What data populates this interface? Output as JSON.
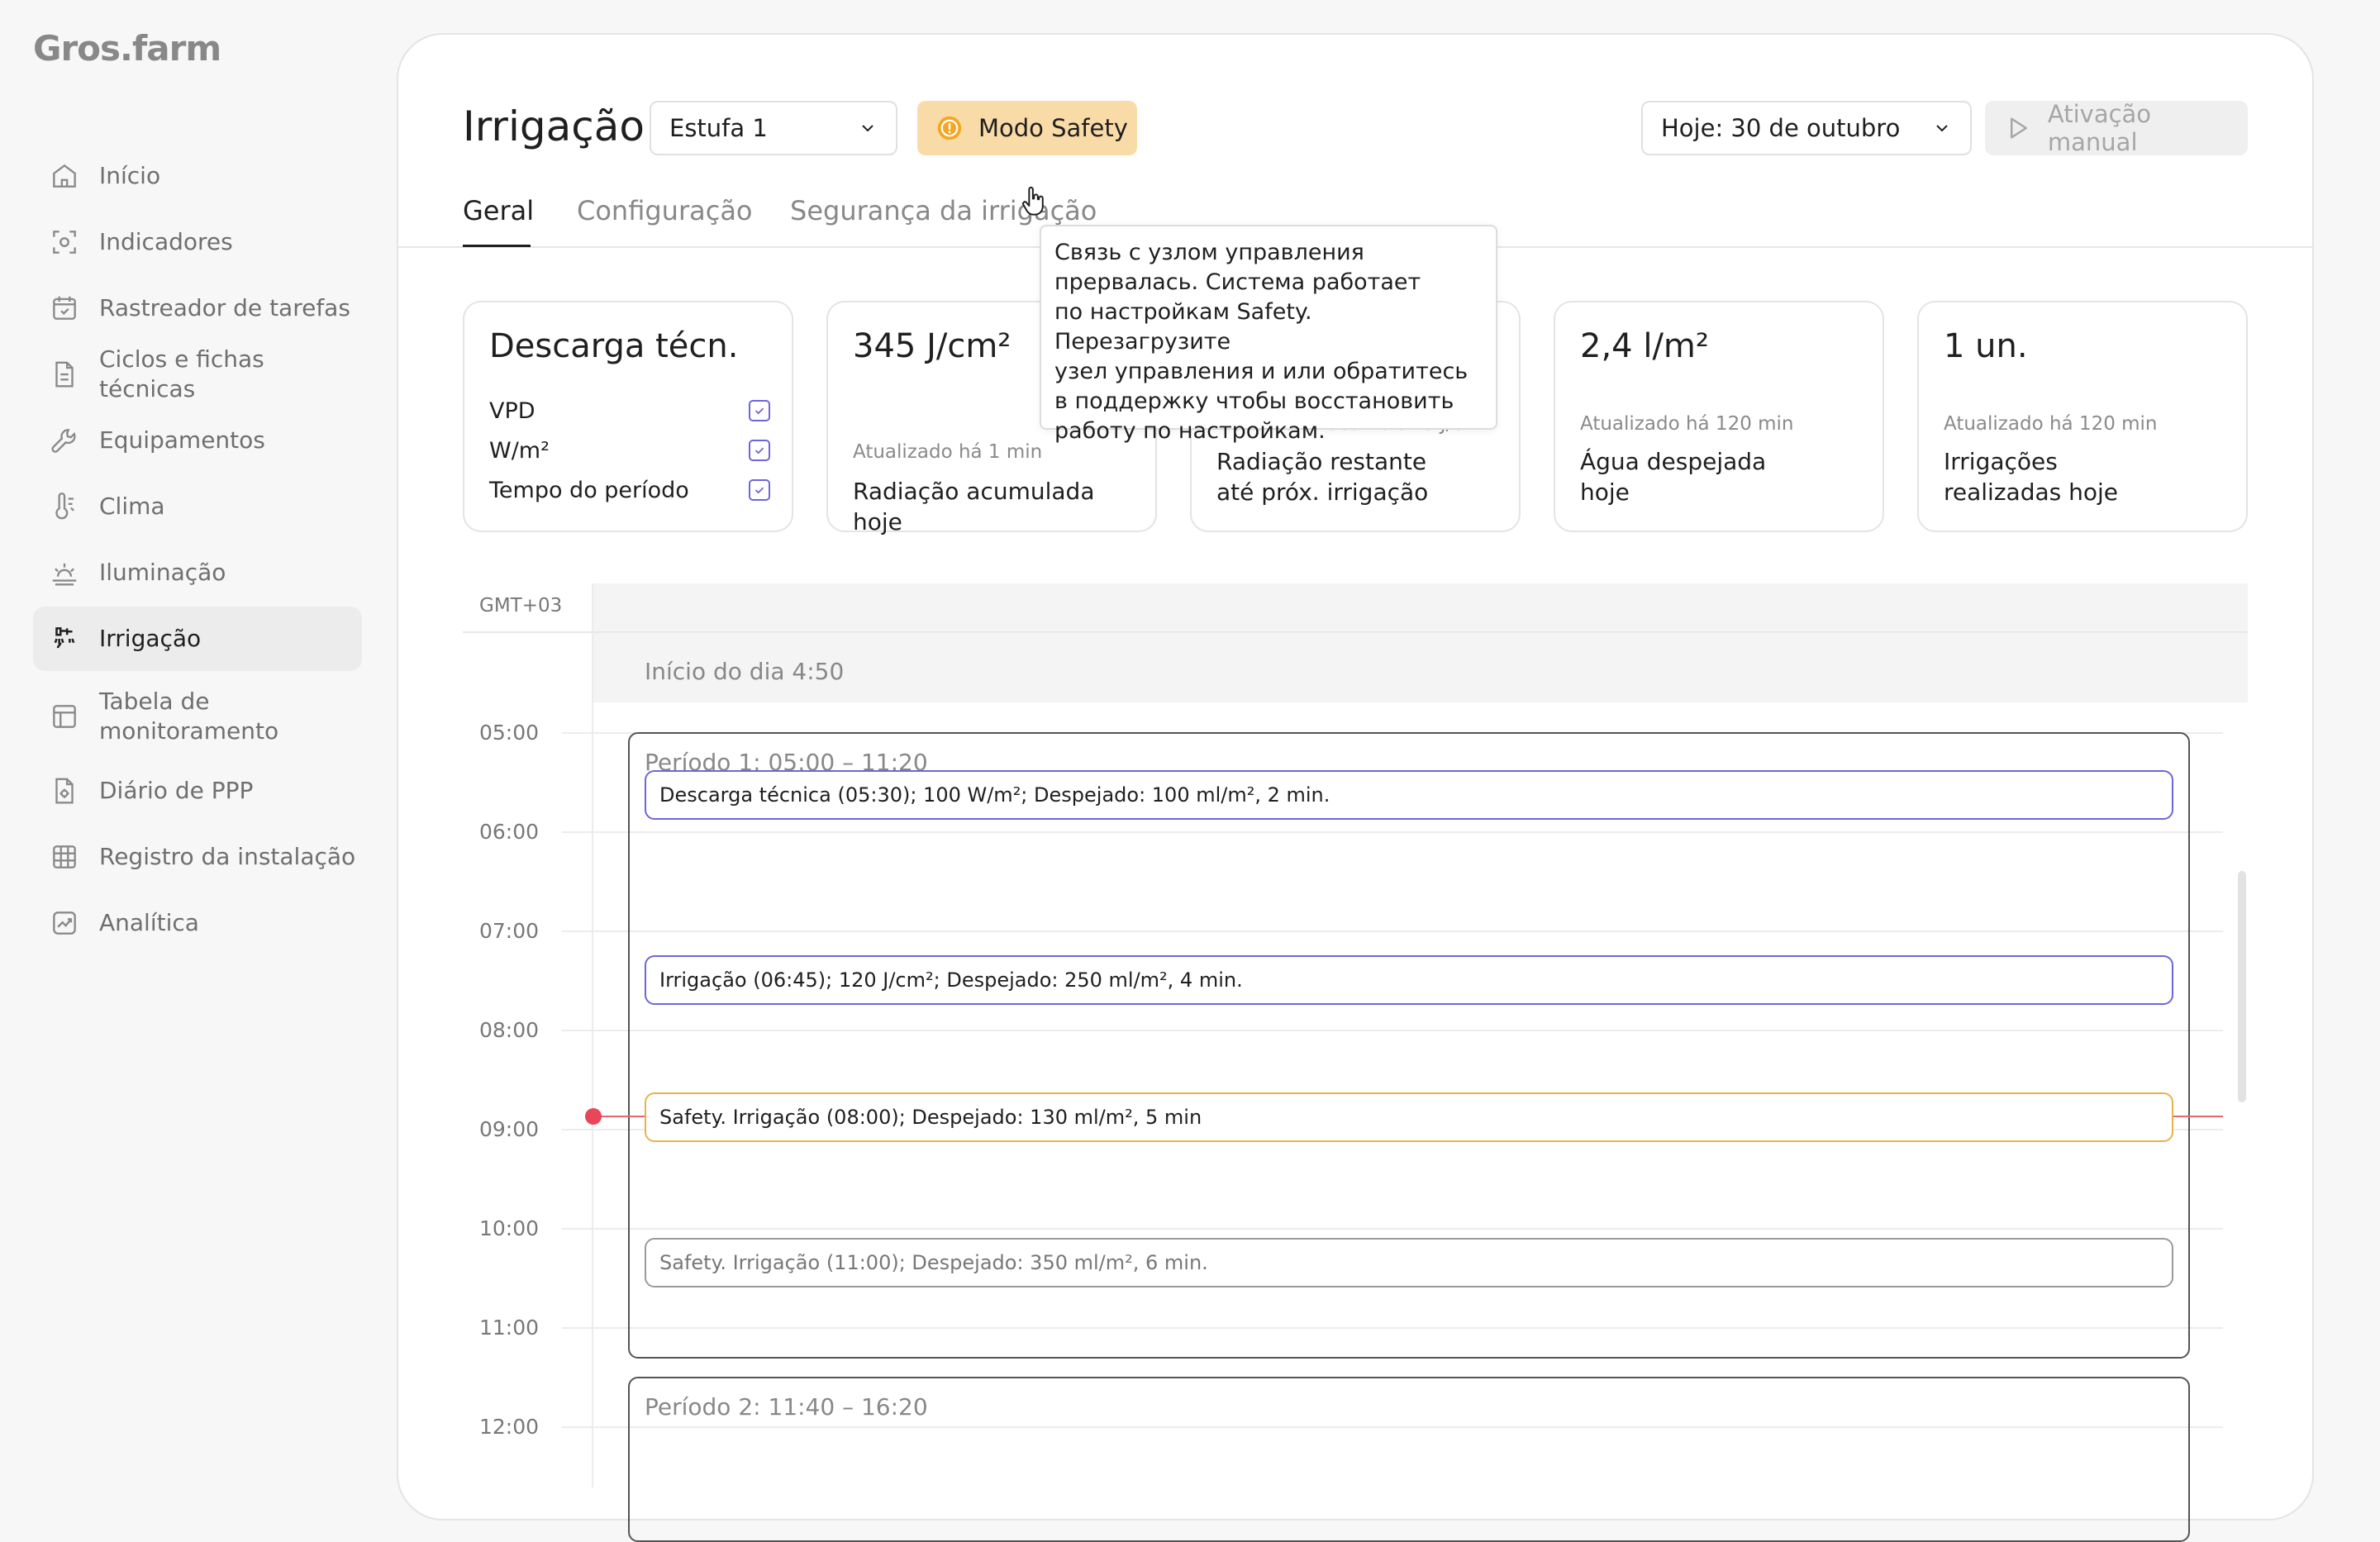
{
  "app": {
    "logo": "Gros.farm"
  },
  "sidebar": {
    "items": [
      {
        "label": "Início",
        "icon": "home-icon"
      },
      {
        "label": "Indicadores",
        "icon": "indicators-icon"
      },
      {
        "label": "Rastreador de tarefas",
        "icon": "calendar-check-icon"
      },
      {
        "label": "Ciclos e fichas técnicas",
        "icon": "document-icon"
      },
      {
        "label": "Equipamentos",
        "icon": "wrench-icon"
      },
      {
        "label": "Clima",
        "icon": "thermometer-icon"
      },
      {
        "label": "Iluminação",
        "icon": "sunrise-icon"
      },
      {
        "label": "Irrigação",
        "icon": "irrigation-icon",
        "active": true
      },
      {
        "label": "Tabela de monitoramento",
        "icon": "table-icon"
      },
      {
        "label": "Diário de PPP",
        "icon": "file-gear-icon"
      },
      {
        "label": "Registro da instalação",
        "icon": "grid-icon"
      },
      {
        "label": "Analítica",
        "icon": "chart-icon"
      }
    ]
  },
  "header": {
    "title": "Irrigação",
    "greenhouse_select": "Estufa 1",
    "safety_button": "Modo Safety",
    "date_select": "Hoje: 30 de outubro",
    "manual_button": "Ativação manual"
  },
  "tabs": [
    {
      "label": "Geral",
      "active": true
    },
    {
      "label": "Configuração"
    },
    {
      "label": "Segurança da irrigação"
    }
  ],
  "tooltip": {
    "lines": [
      "Связь с узлом управления",
      "прервалась. Система работает",
      "по настройкам Safety. Перезагрузите",
      "узел управления и или обратитесь",
      "в поддержку чтобы восстановить",
      "работу по настройкам."
    ]
  },
  "cards": {
    "discharge": {
      "title": "Descarga técn.",
      "options": [
        {
          "label": "VPD",
          "checked": true
        },
        {
          "label": "W/m²",
          "checked": true
        },
        {
          "label": "Tempo do período",
          "checked": true
        }
      ]
    },
    "radiation": {
      "value": "345 J/cm²",
      "updated": "Atualizado há 1 min",
      "desc": "Radiação acumulada hoje"
    },
    "remaining": {
      "updated_partial": "Necessário acumular 0 J/cm²",
      "desc_line1": "Radiação restante",
      "desc_line2": "até próx. irrigação"
    },
    "water": {
      "value": "2,4 l/m²",
      "updated": "Atualizado há 120 min",
      "desc_line1": "Água despejada",
      "desc_line2": "hoje"
    },
    "irrigations": {
      "value": "1 un.",
      "updated": "Atualizado há 120 min",
      "desc_line1": "Irrigações",
      "desc_line2": "realizadas hoje"
    }
  },
  "timeline": {
    "timezone": "GMT+03",
    "day_start": "Início do dia 4:50",
    "hours": [
      "05:00",
      "06:00",
      "07:00",
      "08:00",
      "09:00",
      "10:00",
      "11:00",
      "12:00"
    ],
    "periods": [
      {
        "title": "Período 1: 05:00 – 11:20"
      },
      {
        "title": "Período 2: 11:40 – 16:20"
      }
    ],
    "events": [
      {
        "text": "Descarga técnica (05:30); 100 W/m²; Despejado: 100 ml/m², 2 min.",
        "kind": "purple"
      },
      {
        "text": "Irrigação (06:45); 120 J/cm²; Despejado: 250 ml/m², 4 min.",
        "kind": "purple"
      },
      {
        "text": "Safety. Irrigação (08:00); Despejado: 130 ml/m², 5 min",
        "kind": "orange"
      },
      {
        "text": "Safety. Irrigação (11:00); Despejado: 350 ml/m², 6 min.",
        "kind": "gray"
      }
    ]
  },
  "colors": {
    "accent_purple": "#6e66d8",
    "safety_orange": "#e8b24a",
    "safety_bg": "#f9dba7",
    "now_line": "#e9636b"
  }
}
